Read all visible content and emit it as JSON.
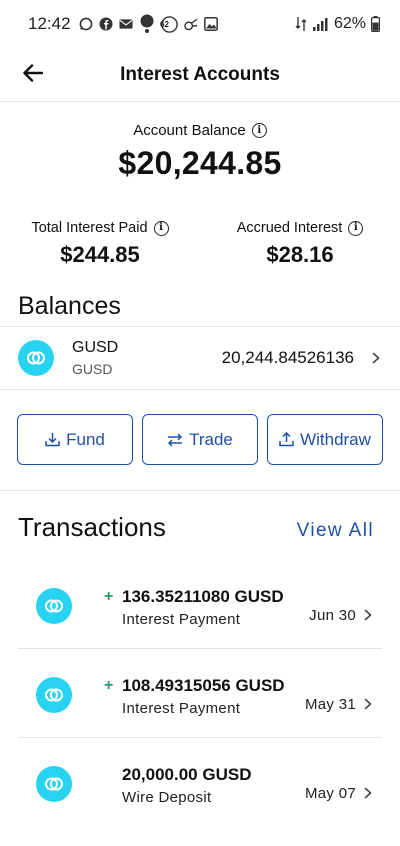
{
  "status_bar": {
    "time": "12:42",
    "notification_badge": "62",
    "battery": "62%",
    "notification_icons": [
      "whatsapp-icon",
      "facebook-icon",
      "mail-icon",
      "dot-icon",
      "badge-icon",
      "app-icon",
      "image-icon"
    ],
    "system_icons": [
      "data-icon",
      "wifi-calling-icon",
      "signal-icon",
      "battery-icon"
    ]
  },
  "header": {
    "title": "Interest Accounts",
    "back_icon": "arrow-left-icon"
  },
  "account": {
    "balance_label": "Account Balance",
    "balance_value": "$20,244.85",
    "total_interest_label": "Total Interest Paid",
    "total_interest_value": "$244.85",
    "accrued_interest_label": "Accrued Interest",
    "accrued_interest_value": "$28.16"
  },
  "balances": {
    "title": "Balances",
    "items": [
      {
        "symbol": "GUSD",
        "name": "GUSD",
        "amount": "20,244.84526136"
      }
    ]
  },
  "actions": {
    "fund": "Fund",
    "trade": "Trade",
    "withdraw": "Withdraw"
  },
  "transactions": {
    "title": "Transactions",
    "view_all": "View All",
    "items": [
      {
        "sign": "+",
        "amount": "136.35211080 GUSD",
        "description": "Interest Payment",
        "date": "Jun 30"
      },
      {
        "sign": "+",
        "amount": "108.49315056 GUSD",
        "description": "Interest Payment",
        "date": "May 31"
      },
      {
        "sign": "",
        "amount": "20,000.00 GUSD",
        "description": "Wire Deposit",
        "date": "May 07"
      }
    ]
  },
  "colors": {
    "accent": "#1f4fa8",
    "coin": "#27d3f0",
    "positive": "#2a9a63",
    "divider": "#e4e4e4"
  }
}
